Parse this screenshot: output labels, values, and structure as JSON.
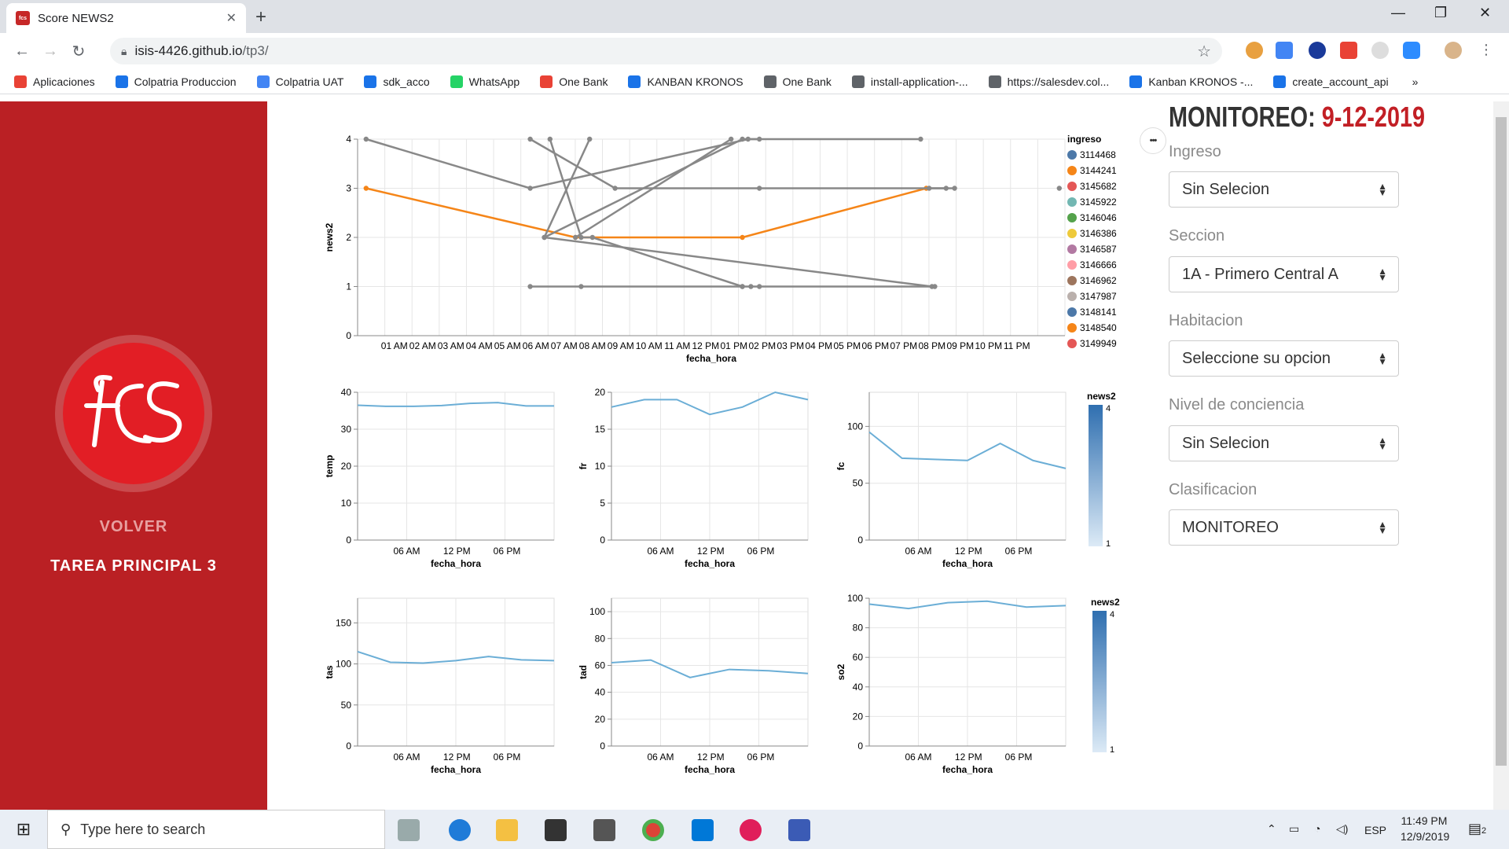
{
  "browser": {
    "tab_title": "Score NEWS2",
    "tab_favicon": "fcs",
    "url_host": "isis-4426.github.io",
    "url_path": "/tp3/",
    "bookmarks": [
      "Aplicaciones",
      "Colpatria Produccion",
      "Colpatria UAT",
      "sdk_acco",
      "WhatsApp",
      "One Bank",
      "KANBAN KRONOS",
      "One Bank",
      "install-application-...",
      "https://salesdev.col...",
      "Kanban KRONOS -...",
      "create_account_api"
    ],
    "bookmark_colors": [
      "#e94235",
      "#1a73e8",
      "#4285f4",
      "#1a73e8",
      "#25d366",
      "#e94235",
      "#1a73e8",
      "#5f6368",
      "#5f6368",
      "#5f6368",
      "#1a73e8",
      "#1a73e8"
    ]
  },
  "sidebar": {
    "volver": "VOLVER",
    "tarea": "TAREA PRINCIPAL 3"
  },
  "panel": {
    "title_prefix": "MONITOREO:",
    "title_date": "9-12-2019",
    "fields": [
      {
        "label": "Ingreso",
        "value": "Sin Selecion"
      },
      {
        "label": "Seccion",
        "value": "1A - Primero Central A"
      },
      {
        "label": "Habitacion",
        "value": "Seleccione su opcion"
      },
      {
        "label": "Nivel de conciencia",
        "value": "Sin Selecion"
      },
      {
        "label": "Clasificacion",
        "value": "MONITOREO"
      }
    ],
    "more_button": "•••"
  },
  "chart_data": [
    {
      "type": "line",
      "ylabel": "news2",
      "xlabel": "fecha_hora",
      "x_ticks": [
        "01 AM",
        "02 AM",
        "03 AM",
        "04 AM",
        "05 AM",
        "06 AM",
        "07 AM",
        "08 AM",
        "09 AM",
        "10 AM",
        "11 AM",
        "12 PM",
        "01 PM",
        "02 PM",
        "03 PM",
        "04 PM",
        "05 PM",
        "06 PM",
        "07 PM",
        "08 PM",
        "09 PM",
        "10 PM",
        "11 PM"
      ],
      "y_ticks": [
        0,
        1,
        2,
        3,
        4
      ],
      "ylim": [
        0,
        4
      ],
      "legend_title": "ingreso",
      "legend": [
        {
          "name": "3114468",
          "color": "#4c78a8"
        },
        {
          "name": "3144241",
          "color": "#f58518"
        },
        {
          "name": "3145682",
          "color": "#e45756"
        },
        {
          "name": "3145922",
          "color": "#72b7b2"
        },
        {
          "name": "3146046",
          "color": "#54a24b"
        },
        {
          "name": "3146386",
          "color": "#eeca3b"
        },
        {
          "name": "3146587",
          "color": "#b279a2"
        },
        {
          "name": "3146666",
          "color": "#ff9da6"
        },
        {
          "name": "3146962",
          "color": "#9d755d"
        },
        {
          "name": "3147987",
          "color": "#bab0ac"
        },
        {
          "name": "3148141",
          "color": "#4c78a8"
        },
        {
          "name": "3148540",
          "color": "#f58518"
        },
        {
          "name": "3149949",
          "color": "#e45756"
        }
      ],
      "series": [
        {
          "color": "#f58518",
          "points": [
            [
              0.0,
              3
            ],
            [
              7.4,
              2
            ],
            [
              13.3,
              2
            ],
            [
              19.8,
              3
            ]
          ]
        },
        {
          "color": "#888888",
          "points": [
            [
              0.0,
              4
            ],
            [
              5.8,
              3
            ],
            [
              13.5,
              4
            ],
            [
              19.6,
              4
            ]
          ]
        },
        {
          "color": "#888888",
          "points": [
            [
              5.8,
              4
            ],
            [
              8.8,
              3
            ],
            [
              13.9,
              3
            ],
            [
              20.5,
              3
            ]
          ]
        },
        {
          "color": "#888888",
          "points": [
            [
              6.5,
              4
            ],
            [
              7.6,
              2
            ],
            [
              8.0,
              2
            ],
            [
              13.3,
              1
            ]
          ]
        },
        {
          "color": "#888888",
          "points": [
            [
              7.9,
              4
            ],
            [
              6.3,
              2
            ],
            [
              20.0,
              1
            ]
          ]
        },
        {
          "color": "#888888",
          "points": [
            [
              5.8,
              1
            ],
            [
              7.6,
              1
            ],
            [
              13.3,
              1
            ],
            [
              13.6,
              1
            ],
            [
              13.9,
              1
            ],
            [
              20.1,
              1
            ]
          ]
        },
        {
          "color": "#888888",
          "points": [
            [
              6.3,
              2
            ],
            [
              13.3,
              4
            ],
            [
              13.9,
              4
            ]
          ]
        },
        {
          "color": "#888888",
          "points": [
            [
              7.4,
              2
            ],
            [
              12.9,
              4
            ]
          ]
        },
        {
          "color": "#888888",
          "points": [
            [
              19.9,
              3
            ],
            [
              20.8,
              3
            ]
          ]
        },
        {
          "color": "#888888",
          "points": [
            [
              24.5,
              3
            ]
          ]
        }
      ]
    },
    {
      "type": "line",
      "ylabel": "temp",
      "xlabel": "fecha_hora",
      "x_ticks": [
        "06 AM",
        "12 PM",
        "06 PM"
      ],
      "y_ticks": [
        0,
        10,
        20,
        30,
        40
      ],
      "ylim": [
        0,
        40
      ],
      "values": [
        36.5,
        36.2,
        36.2,
        36.4,
        37.0,
        37.2,
        36.3,
        36.3
      ]
    },
    {
      "type": "line",
      "ylabel": "fr",
      "xlabel": "fecha_hora",
      "x_ticks": [
        "06 AM",
        "12 PM",
        "06 PM"
      ],
      "y_ticks": [
        0,
        5,
        10,
        15,
        20
      ],
      "ylim": [
        0,
        20
      ],
      "values": [
        18,
        19,
        19,
        17,
        18,
        20,
        19
      ]
    },
    {
      "type": "line",
      "ylabel": "fc",
      "xlabel": "fecha_hora",
      "x_ticks": [
        "06 AM",
        "12 PM",
        "06 PM"
      ],
      "y_ticks": [
        0,
        50,
        100
      ],
      "ylim": [
        0,
        130
      ],
      "values": [
        95,
        72,
        71,
        70,
        85,
        70,
        63
      ]
    },
    {
      "type": "line",
      "ylabel": "tas",
      "xlabel": "fecha_hora",
      "x_ticks": [
        "06 AM",
        "12 PM",
        "06 PM"
      ],
      "y_ticks": [
        0,
        50,
        100,
        150
      ],
      "ylim": [
        0,
        180
      ],
      "values": [
        115,
        102,
        101,
        104,
        109,
        105,
        104
      ]
    },
    {
      "type": "line",
      "ylabel": "tad",
      "xlabel": "fecha_hora",
      "x_ticks": [
        "06 AM",
        "12 PM",
        "06 PM"
      ],
      "y_ticks": [
        0,
        20,
        40,
        60,
        80,
        100
      ],
      "ylim": [
        0,
        110
      ],
      "values": [
        62,
        64,
        51,
        57,
        56,
        54
      ]
    },
    {
      "type": "line",
      "ylabel": "so2",
      "xlabel": "fecha_hora",
      "x_ticks": [
        "06 AM",
        "12 PM",
        "06 PM"
      ],
      "y_ticks": [
        0,
        20,
        40,
        60,
        80,
        100
      ],
      "ylim": [
        0,
        100
      ],
      "values": [
        96,
        93,
        97,
        98,
        94,
        95
      ]
    }
  ],
  "gradient_legends": [
    {
      "title": "news2",
      "max": "4",
      "min": "1"
    },
    {
      "title": "news2",
      "max": "4",
      "min": "1"
    }
  ],
  "taskbar": {
    "search_placeholder": "Type here to search",
    "lang": "ESP",
    "time": "11:49 PM",
    "date": "12/9/2019",
    "notif_count": "2"
  }
}
